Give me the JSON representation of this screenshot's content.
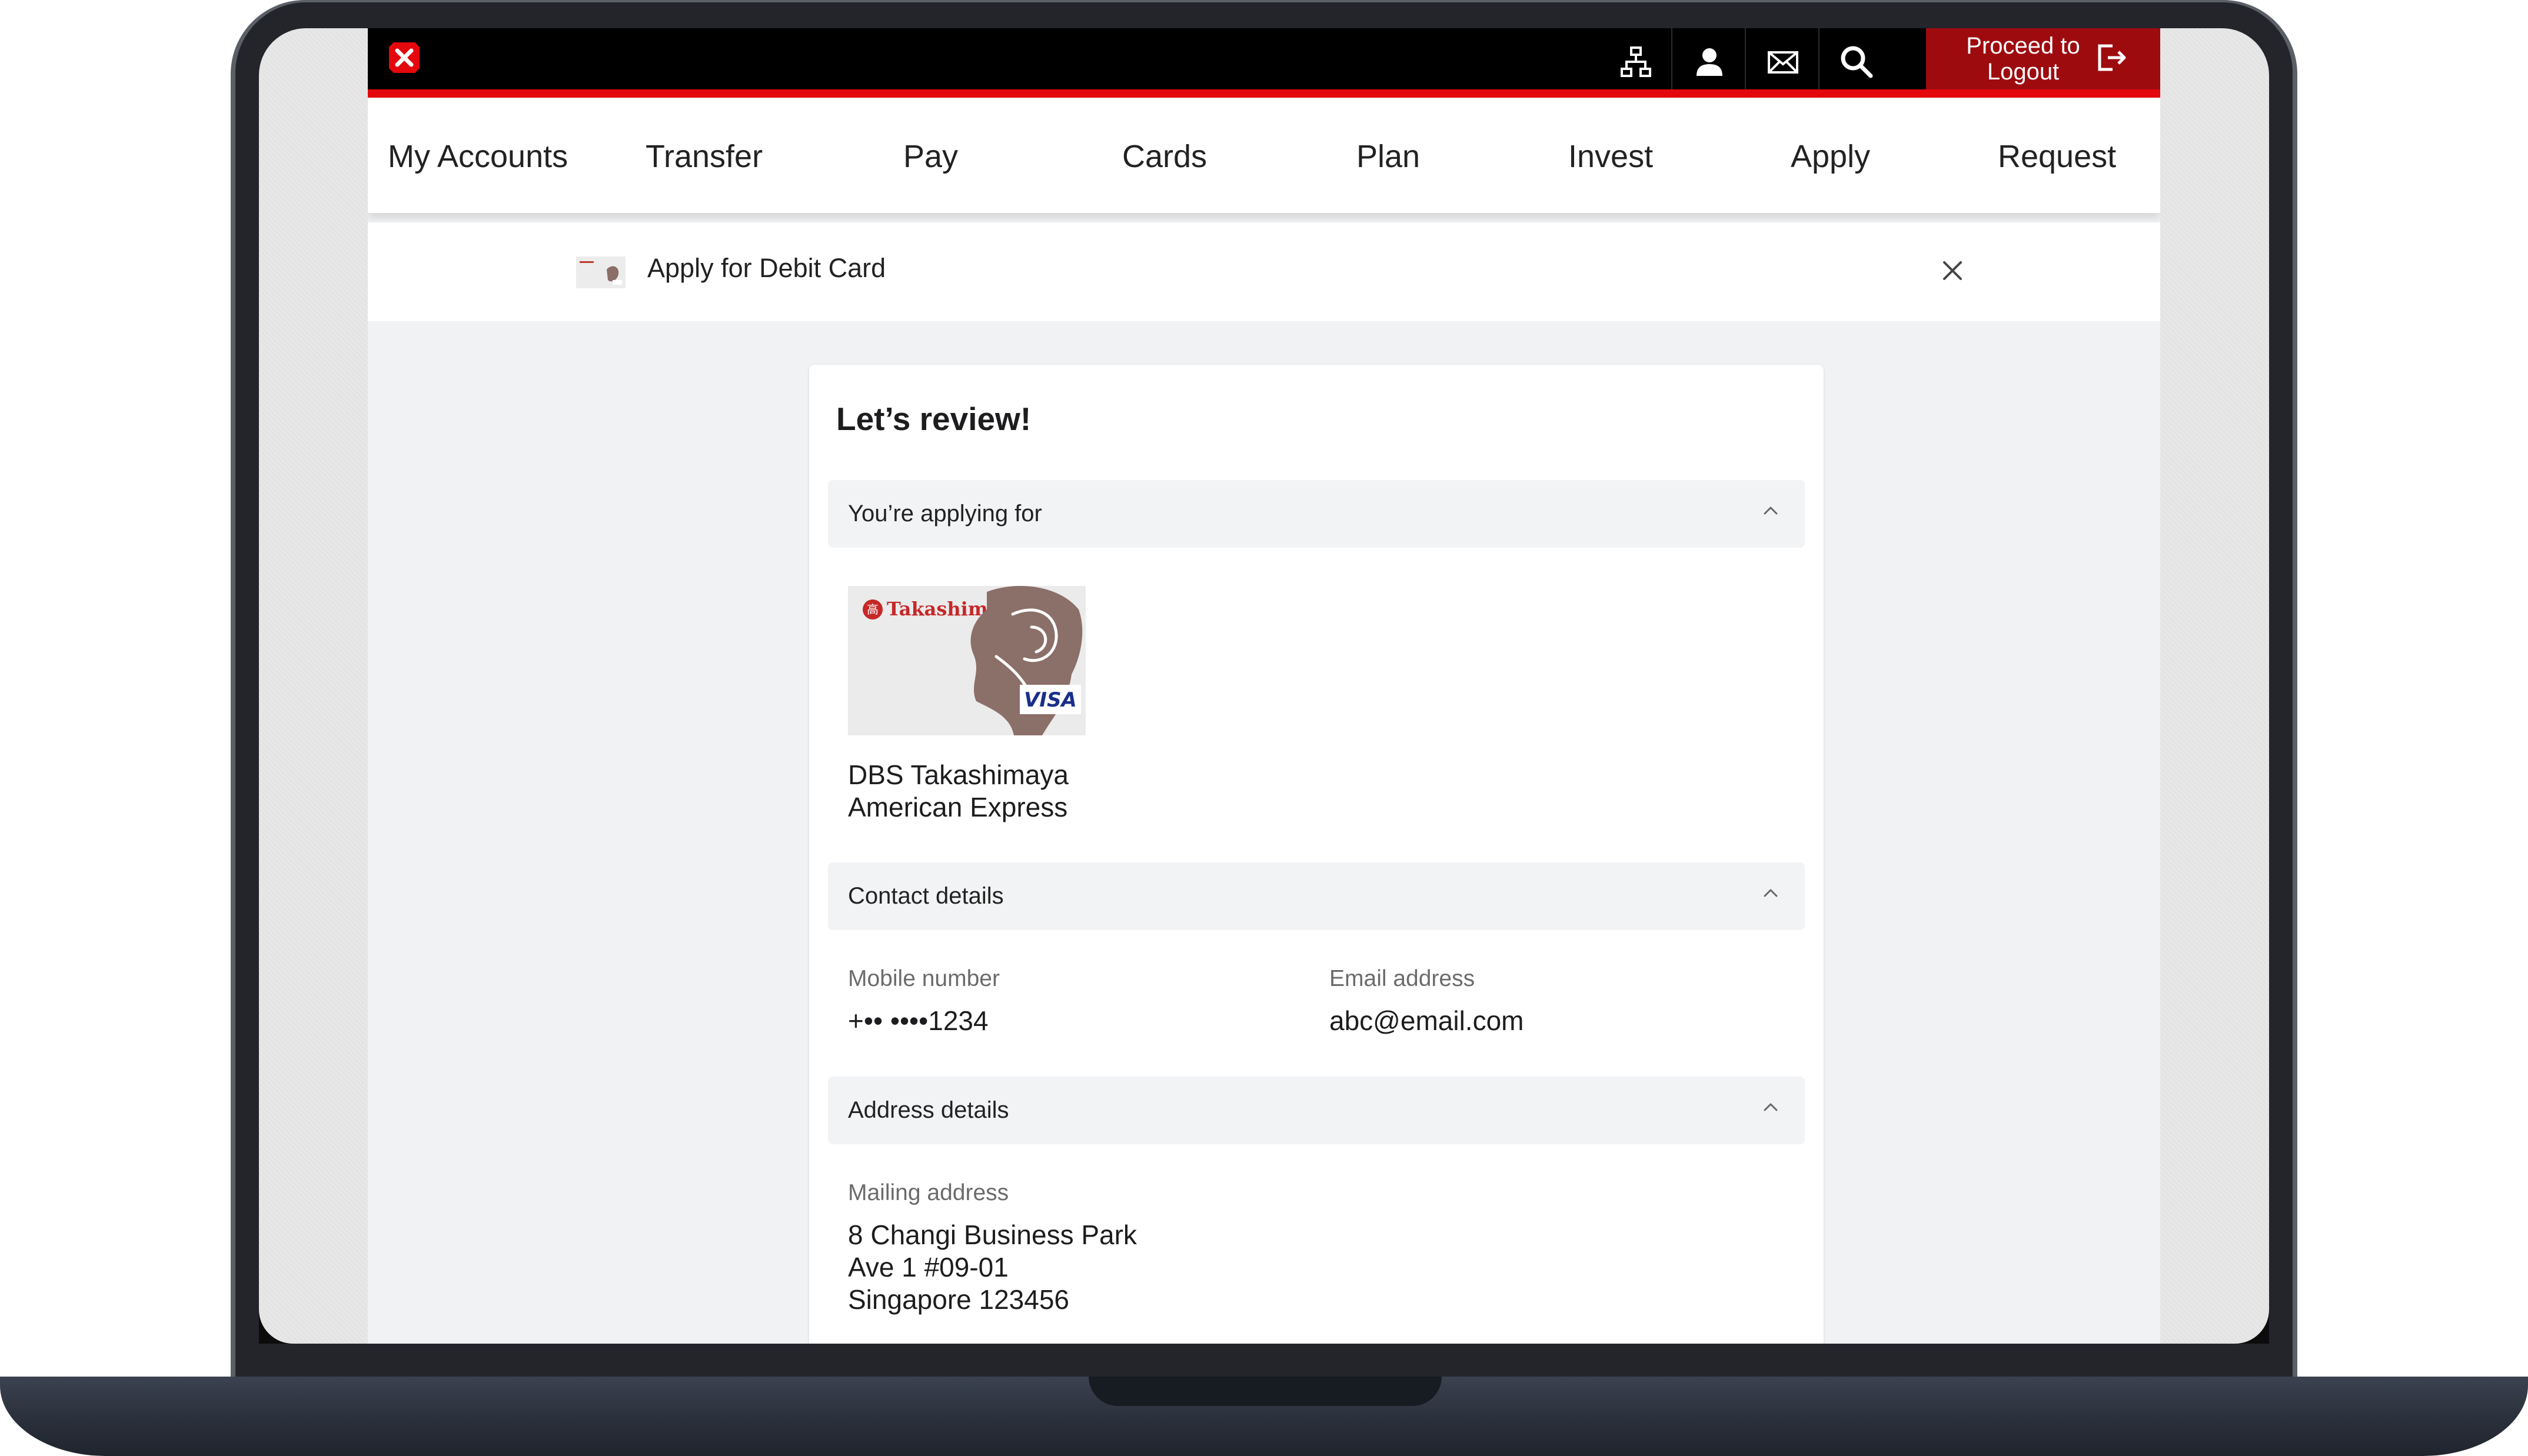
{
  "colors": {
    "brand_red": "#e4080d",
    "logout_bg": "#9e0b0f",
    "topbar_bg": "#000000"
  },
  "topbar": {
    "icons": [
      "sitemap-icon",
      "profile-icon",
      "mail-icon",
      "search-icon"
    ],
    "logout_line1": "Proceed to",
    "logout_line2": "Logout"
  },
  "nav": {
    "items": [
      "My Accounts",
      "Transfer",
      "Pay",
      "Cards",
      "Plan",
      "Invest",
      "Apply",
      "Request"
    ]
  },
  "subheader": {
    "title": "Apply for Debit Card"
  },
  "review": {
    "title": "Let’s review!",
    "applying_section": {
      "label": "You’re applying for",
      "card_brand": "Takashimaya",
      "card_network": "VISA",
      "product_line1": "DBS Takashimaya",
      "product_line2": "American Express"
    },
    "contact_section": {
      "label": "Contact details",
      "mobile_label": "Mobile number",
      "mobile_value": "+•• ••••1234",
      "email_label": "Email address",
      "email_value": "abc@email.com"
    },
    "address_section": {
      "label": "Address details",
      "mailing_label": "Mailing address",
      "address_line1": "8 Changi Business Park",
      "address_line2": "Ave 1 #09-01",
      "address_line3": "Singapore 123456"
    }
  }
}
